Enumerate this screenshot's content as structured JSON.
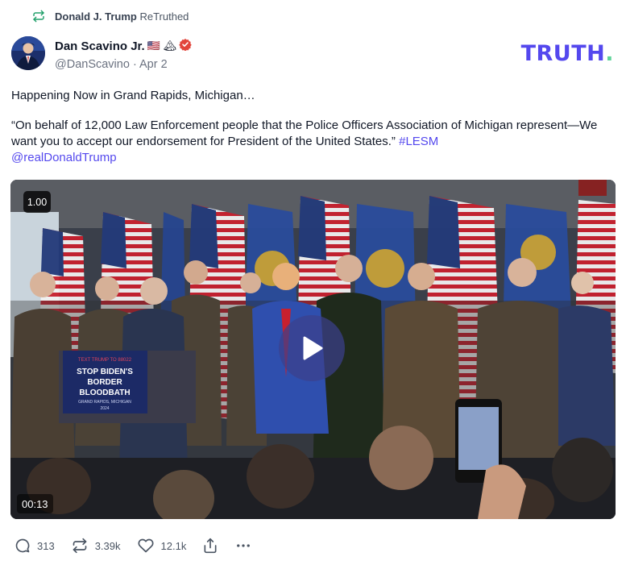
{
  "retruth": {
    "icon": "retruth-icon",
    "name": "Donald J. Trump",
    "suffix": "ReTruthed"
  },
  "post": {
    "author": {
      "display_name": "Dan Scavino Jr.",
      "emoji": "🇺🇸 🏔",
      "verified": true,
      "handle": "@DanScavino",
      "date": "Apr 2"
    },
    "paragraphs": {
      "p1": "Happening Now in Grand Rapids, Michigan…",
      "p2_text": "“On behalf of 12,000 Law Enforcement people that the Police Officers Association of Michigan represent—We want you to accept our endorsement for President of the United States.” ",
      "p2_hashtag": "#LESM",
      "p2_mention": "@realDonaldTrump"
    },
    "video": {
      "speed": "1.00",
      "timestamp": "00:13",
      "podium_sign": {
        "top": "TEXT TRUMP TO 88022",
        "line1": "STOP BIDEN'S",
        "line2": "BORDER",
        "line3": "BLOODBATH",
        "city": "GRAND RAPIDS, MICHIGAN",
        "year": "2024"
      }
    },
    "actions": {
      "replies": "313",
      "retruths": "3.39k",
      "likes": "12.1k"
    }
  },
  "brand": {
    "logo_main": "TRUTH",
    "logo_dot": ".",
    "accent": "#5448ee",
    "dot_color": "#5fd39a"
  },
  "colors": {
    "verified": "#e2453c",
    "retruth_icon": "#22a06b",
    "link": "#5448ee"
  }
}
